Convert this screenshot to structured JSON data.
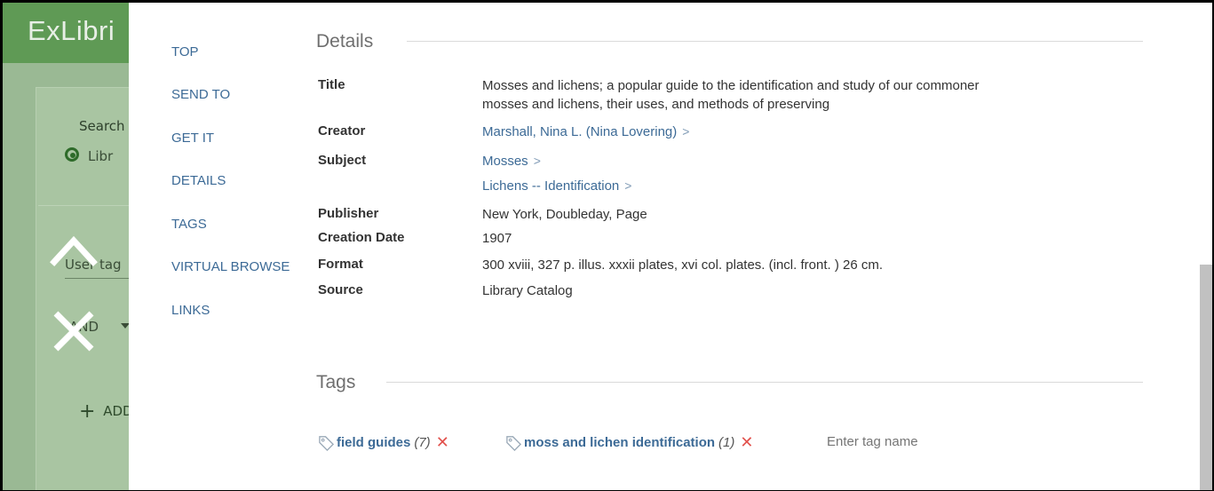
{
  "background": {
    "logo": "ExLibri",
    "search_label": "Search fo",
    "radio_label": "Libr",
    "user_tags_label": "User tag",
    "and_select": "AND",
    "add_label": "ADD",
    "add_symbol": "+"
  },
  "nav": {
    "items": [
      {
        "label": "TOP"
      },
      {
        "label": "SEND TO"
      },
      {
        "label": "GET IT"
      },
      {
        "label": "DETAILS"
      },
      {
        "label": "TAGS"
      },
      {
        "label": "VIRTUAL BROWSE"
      },
      {
        "label": "LINKS"
      }
    ]
  },
  "details": {
    "heading": "Details",
    "title_label": "Title",
    "title_line1": "Mosses and lichens; a popular guide to the identification and study of our commoner",
    "title_line2": "mosses and lichens, their uses, and methods of preserving",
    "creator_label": "Creator",
    "creator_value": "Marshall, Nina L. (Nina Lovering)",
    "subject_label": "Subject",
    "subjects": [
      "Mosses",
      "Lichens -- Identification"
    ],
    "publisher_label": "Publisher",
    "publisher_value": "New York, Doubleday, Page",
    "creation_date_label": "Creation Date",
    "creation_date_value": "1907",
    "format_label": "Format",
    "format_value": "300 xviii, 327 p. illus. xxxii plates, xvi col. plates. (incl. front. ) 26 cm.",
    "source_label": "Source",
    "source_value": "Library Catalog",
    "chevron": ">"
  },
  "tags": {
    "heading": "Tags",
    "items": [
      {
        "name": "field guides",
        "count": "(7)"
      },
      {
        "name": "moss and lichen identification",
        "count": "(1)"
      }
    ],
    "remove_symbol": "✕",
    "input_placeholder": "Enter tag name"
  },
  "colors": {
    "link": "#3c6a96",
    "remove": "#e2524d",
    "header_bg": "#5f9a55"
  }
}
